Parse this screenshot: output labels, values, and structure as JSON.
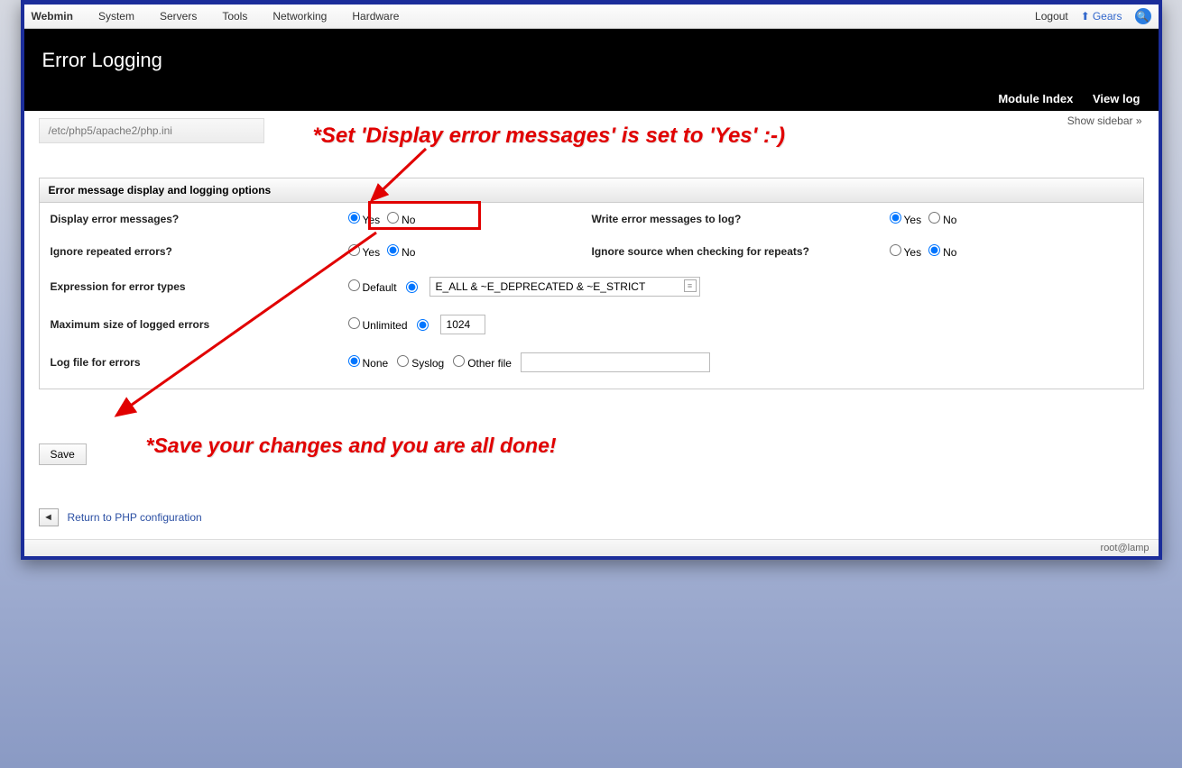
{
  "topmenu": {
    "brand": "Webmin",
    "items": [
      "System",
      "Servers",
      "Tools",
      "Networking",
      "Hardware"
    ],
    "logout": "Logout",
    "gears": "Gears"
  },
  "header": {
    "title": "Error Logging",
    "module_index": "Module Index",
    "view_log": "View log"
  },
  "breadcrumb": "/etc/php5/apache2/php.ini",
  "show_sidebar": "Show sidebar »",
  "panel": {
    "title": "Error message display and logging options",
    "labels": {
      "display_errors": "Display error messages?",
      "write_log": "Write error messages to log?",
      "ignore_repeated": "Ignore repeated errors?",
      "ignore_source": "Ignore source when checking for repeats?",
      "expr": "Expression for error types",
      "max_size": "Maximum size of logged errors",
      "log_file": "Log file for errors"
    },
    "opts": {
      "yes": "Yes",
      "no": "No",
      "default": "Default",
      "unlimited": "Unlimited",
      "none": "None",
      "syslog": "Syslog",
      "other": "Other file"
    },
    "values": {
      "expr": "E_ALL & ~E_DEPRECATED & ~E_STRICT",
      "max_size": "1024",
      "other_file": ""
    }
  },
  "save": "Save",
  "return_link": "Return to PHP configuration",
  "footer": "root@lamp",
  "annotations": {
    "line1": "*Set 'Display error messages' is set to 'Yes' :-)",
    "line2": "*Save your changes and you are all done!"
  }
}
